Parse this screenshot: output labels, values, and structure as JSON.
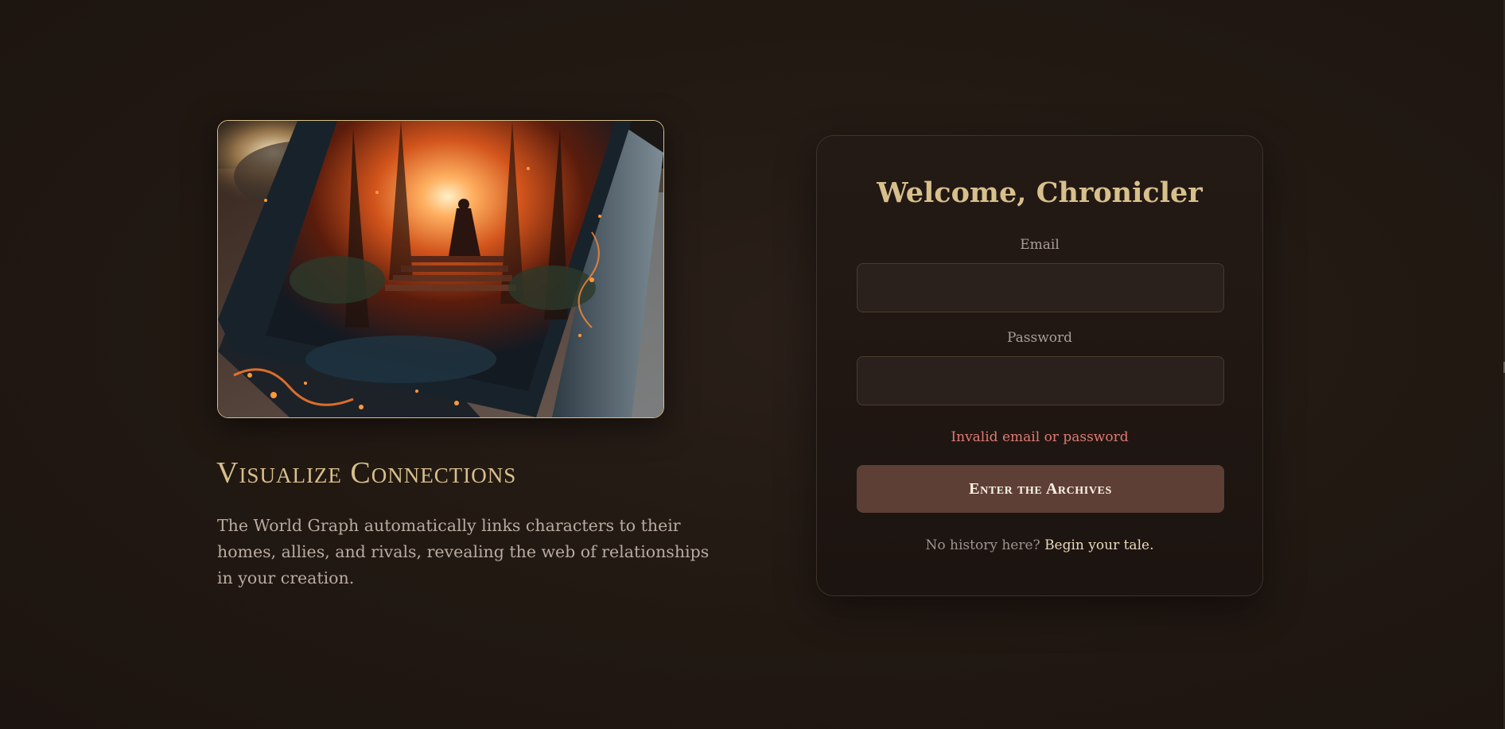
{
  "showcase": {
    "image_alt": "Illustrated tome with a glowing fiery throne scene on its cover",
    "title": "Visualize Connections",
    "description": "The World Graph automatically links characters to their homes, allies, and rivals, revealing the web of relationships in your creation."
  },
  "login": {
    "title": "Welcome, Chronicler",
    "email_label": "Email",
    "email_value": "",
    "password_label": "Password",
    "password_value": "",
    "error_message": "Invalid email or password",
    "submit_label": "Enter the Archives",
    "signup_prompt": "No history here?",
    "signup_link": "Begin your tale."
  },
  "colors": {
    "background": "#201712",
    "gold_accent": "#d8c08c",
    "error": "#e07a72",
    "button": "#5d3f36"
  }
}
